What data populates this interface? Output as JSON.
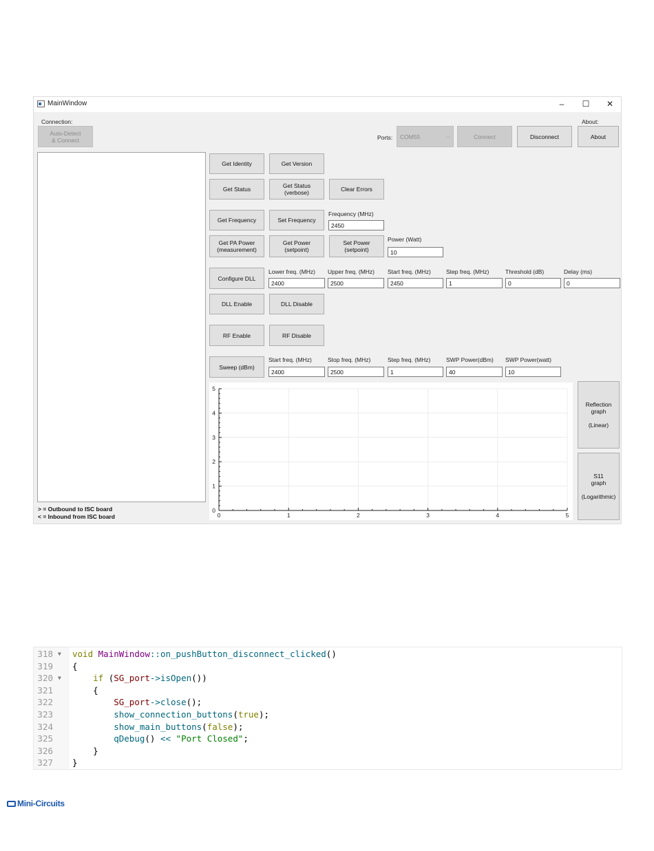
{
  "window": {
    "title": "MainWindow",
    "controls": {
      "minimize": "–",
      "maximize": "☐",
      "close": "✕"
    }
  },
  "connection": {
    "group_label": "Connection:",
    "auto_detect_line1": "Auto-Detect",
    "auto_detect_line2": "& Connect",
    "ports_label": "Ports:",
    "port_value": "COM55",
    "connect_label": "Connect",
    "disconnect_label": "Disconnect"
  },
  "about": {
    "group_label": "About:",
    "button_label": "About"
  },
  "commands": {
    "get_identity": "Get Identity",
    "get_version": "Get Version",
    "get_status": "Get Status",
    "get_status_verbose_1": "Get Status",
    "get_status_verbose_2": "(verbose)",
    "clear_errors": "Clear Errors",
    "get_frequency": "Get Frequency",
    "set_frequency": "Set Frequency",
    "frequency_label": "Frequency (MHz)",
    "frequency_value": "2450",
    "get_pa_power_1": "Get PA Power",
    "get_pa_power_2": "(measurement)",
    "get_power_1": "Get Power",
    "get_power_2": "(setpoint)",
    "set_power_1": "Set Power",
    "set_power_2": "(setpoint)",
    "power_label": "Power (Watt)",
    "power_value": "10"
  },
  "dll": {
    "configure": "Configure DLL",
    "lower_label": "Lower freq. (MHz)",
    "lower_value": "2400",
    "upper_label": "Upper freq. (MHz)",
    "upper_value": "2500",
    "start_label": "Start freq. (MHz)",
    "start_value": "2450",
    "step_label": "Step freq. (MHz)",
    "step_value": "1",
    "threshold_label": "Threshold (dB)",
    "threshold_value": "0",
    "delay_label": "Delay (ms)",
    "delay_value": "0",
    "enable": "DLL Enable",
    "disable": "DLL Disable"
  },
  "rf": {
    "enable": "RF Enable",
    "disable": "RF Disable"
  },
  "sweep": {
    "button": "Sweep (dBm)",
    "start_label": "Start freq. (MHz)",
    "start_value": "2400",
    "stop_label": "Stop freq. (MHz)",
    "stop_value": "2500",
    "step_label": "Step freq. (MHz)",
    "step_value": "1",
    "swp_dbm_label": "SWP Power(dBm)",
    "swp_dbm_value": "40",
    "swp_watt_label": "SWP Power(watt)",
    "swp_watt_value": "10"
  },
  "graph_buttons": {
    "reflection_1": "Reflection",
    "reflection_2": "graph",
    "reflection_3": "(Linear)",
    "s11_1": "S11",
    "s11_2": "graph",
    "s11_3": "(Logarithmic)"
  },
  "log_legend": {
    "outbound": "> = Outbound to ISC board",
    "inbound": "< = Inbound from ISC board"
  },
  "chart_data": {
    "type": "line",
    "x_ticks": [
      "0",
      "1",
      "2",
      "3",
      "4",
      "5"
    ],
    "y_ticks": [
      "0",
      "1",
      "2",
      "3",
      "4",
      "5"
    ],
    "xlim": [
      0,
      5
    ],
    "ylim": [
      0,
      5
    ],
    "grid": true,
    "series": []
  },
  "code": {
    "lines": [
      {
        "num": "318",
        "fold": "▼",
        "text": "void MainWindow::on_pushButton_disconnect_clicked()"
      },
      {
        "num": "319",
        "fold": "",
        "text": "{"
      },
      {
        "num": "320",
        "fold": "▼",
        "text": "    if (SG_port->isOpen())"
      },
      {
        "num": "321",
        "fold": "",
        "text": "    {"
      },
      {
        "num": "322",
        "fold": "",
        "text": "        SG_port->close();"
      },
      {
        "num": "323",
        "fold": "",
        "text": "        show_connection_buttons(true);"
      },
      {
        "num": "324",
        "fold": "",
        "text": "        show_main_buttons(false);"
      },
      {
        "num": "325",
        "fold": "",
        "text": "        qDebug() << \"Port Closed\";"
      },
      {
        "num": "326",
        "fold": "",
        "text": "    }"
      },
      {
        "num": "327",
        "fold": "",
        "text": "}"
      }
    ]
  },
  "footer": {
    "logo_text": "Mini-Circuits"
  }
}
